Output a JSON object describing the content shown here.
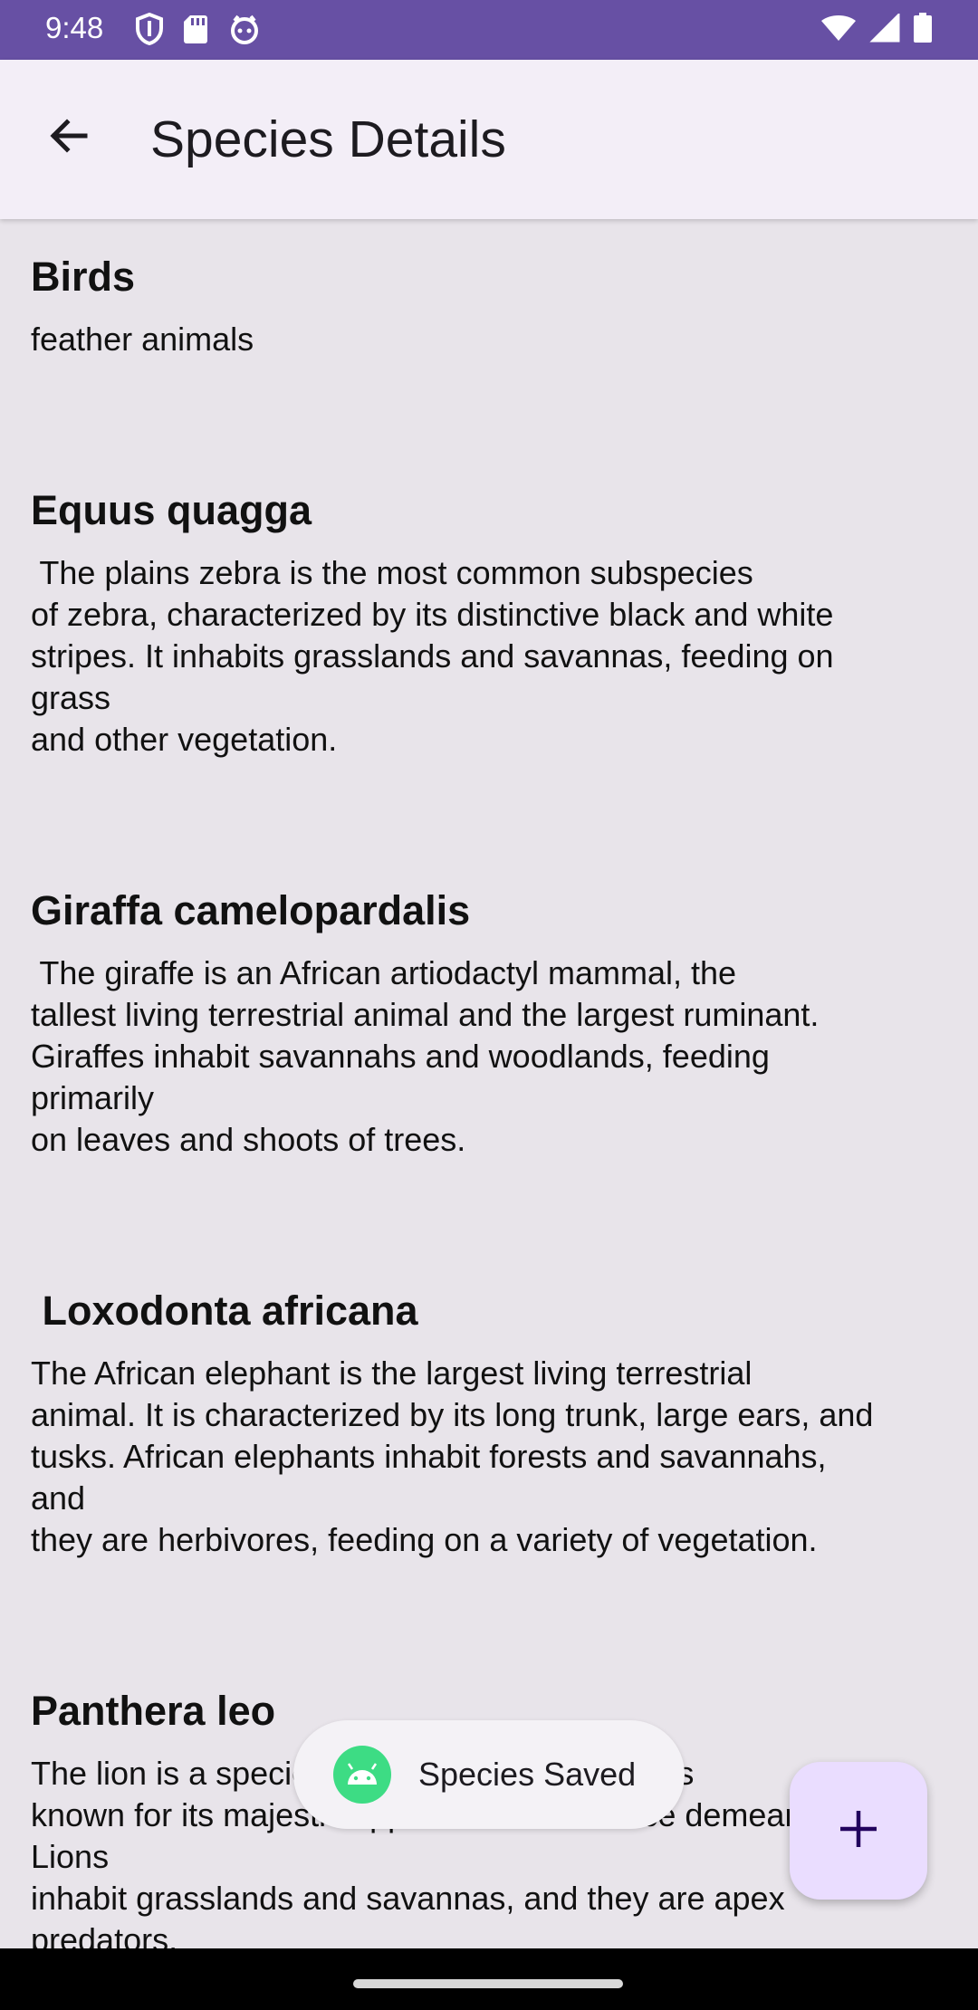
{
  "status_bar": {
    "time": "9:48",
    "icons_left": [
      "shield-icon",
      "sd-card-icon",
      "face-icon"
    ],
    "icons_right": [
      "wifi-icon",
      "signal-icon",
      "battery-icon"
    ],
    "color": "#6750A4"
  },
  "app_bar": {
    "title": "Species Details",
    "back_icon": "arrow-back-icon"
  },
  "species": [
    {
      "name": "Birds",
      "description_lines": [
        "feather animals"
      ]
    },
    {
      "name": "Equus quagga",
      "description_lines": [
        " The plains zebra is the most common subspecies",
        "of zebra, characterized by its distinctive black and white",
        "stripes. It inhabits grasslands and savannas, feeding on",
        "grass",
        "and other vegetation."
      ]
    },
    {
      "name": "Giraffa camelopardalis",
      "description_lines": [
        " The giraffe is an African artiodactyl mammal, the",
        "tallest living terrestrial animal and the largest ruminant.",
        "Giraffes inhabit savannahs and woodlands, feeding",
        "primarily",
        "on leaves and shoots of trees."
      ]
    },
    {
      "name": " Loxodonta africana",
      "description_lines": [
        "The African elephant is the largest living terrestrial",
        "animal. It is characterized by its long trunk, large ears, and",
        "tusks. African elephants inhabit forests and savannahs,",
        "and",
        "they are herbivores, feeding on a variety of vegetation."
      ]
    },
    {
      "name": "Panthera leo",
      "description_lines": [
        "The lion is a species in the family Felidae. It is",
        "known for its majestic appearance and fierce demeanor.",
        "Lions",
        "inhabit grasslands and savannas, and they are apex",
        "predators."
      ]
    }
  ],
  "toast": {
    "text": "Species Saved",
    "icon": "android-icon"
  },
  "fab": {
    "icon": "plus-icon",
    "color": "#EADDFF"
  }
}
